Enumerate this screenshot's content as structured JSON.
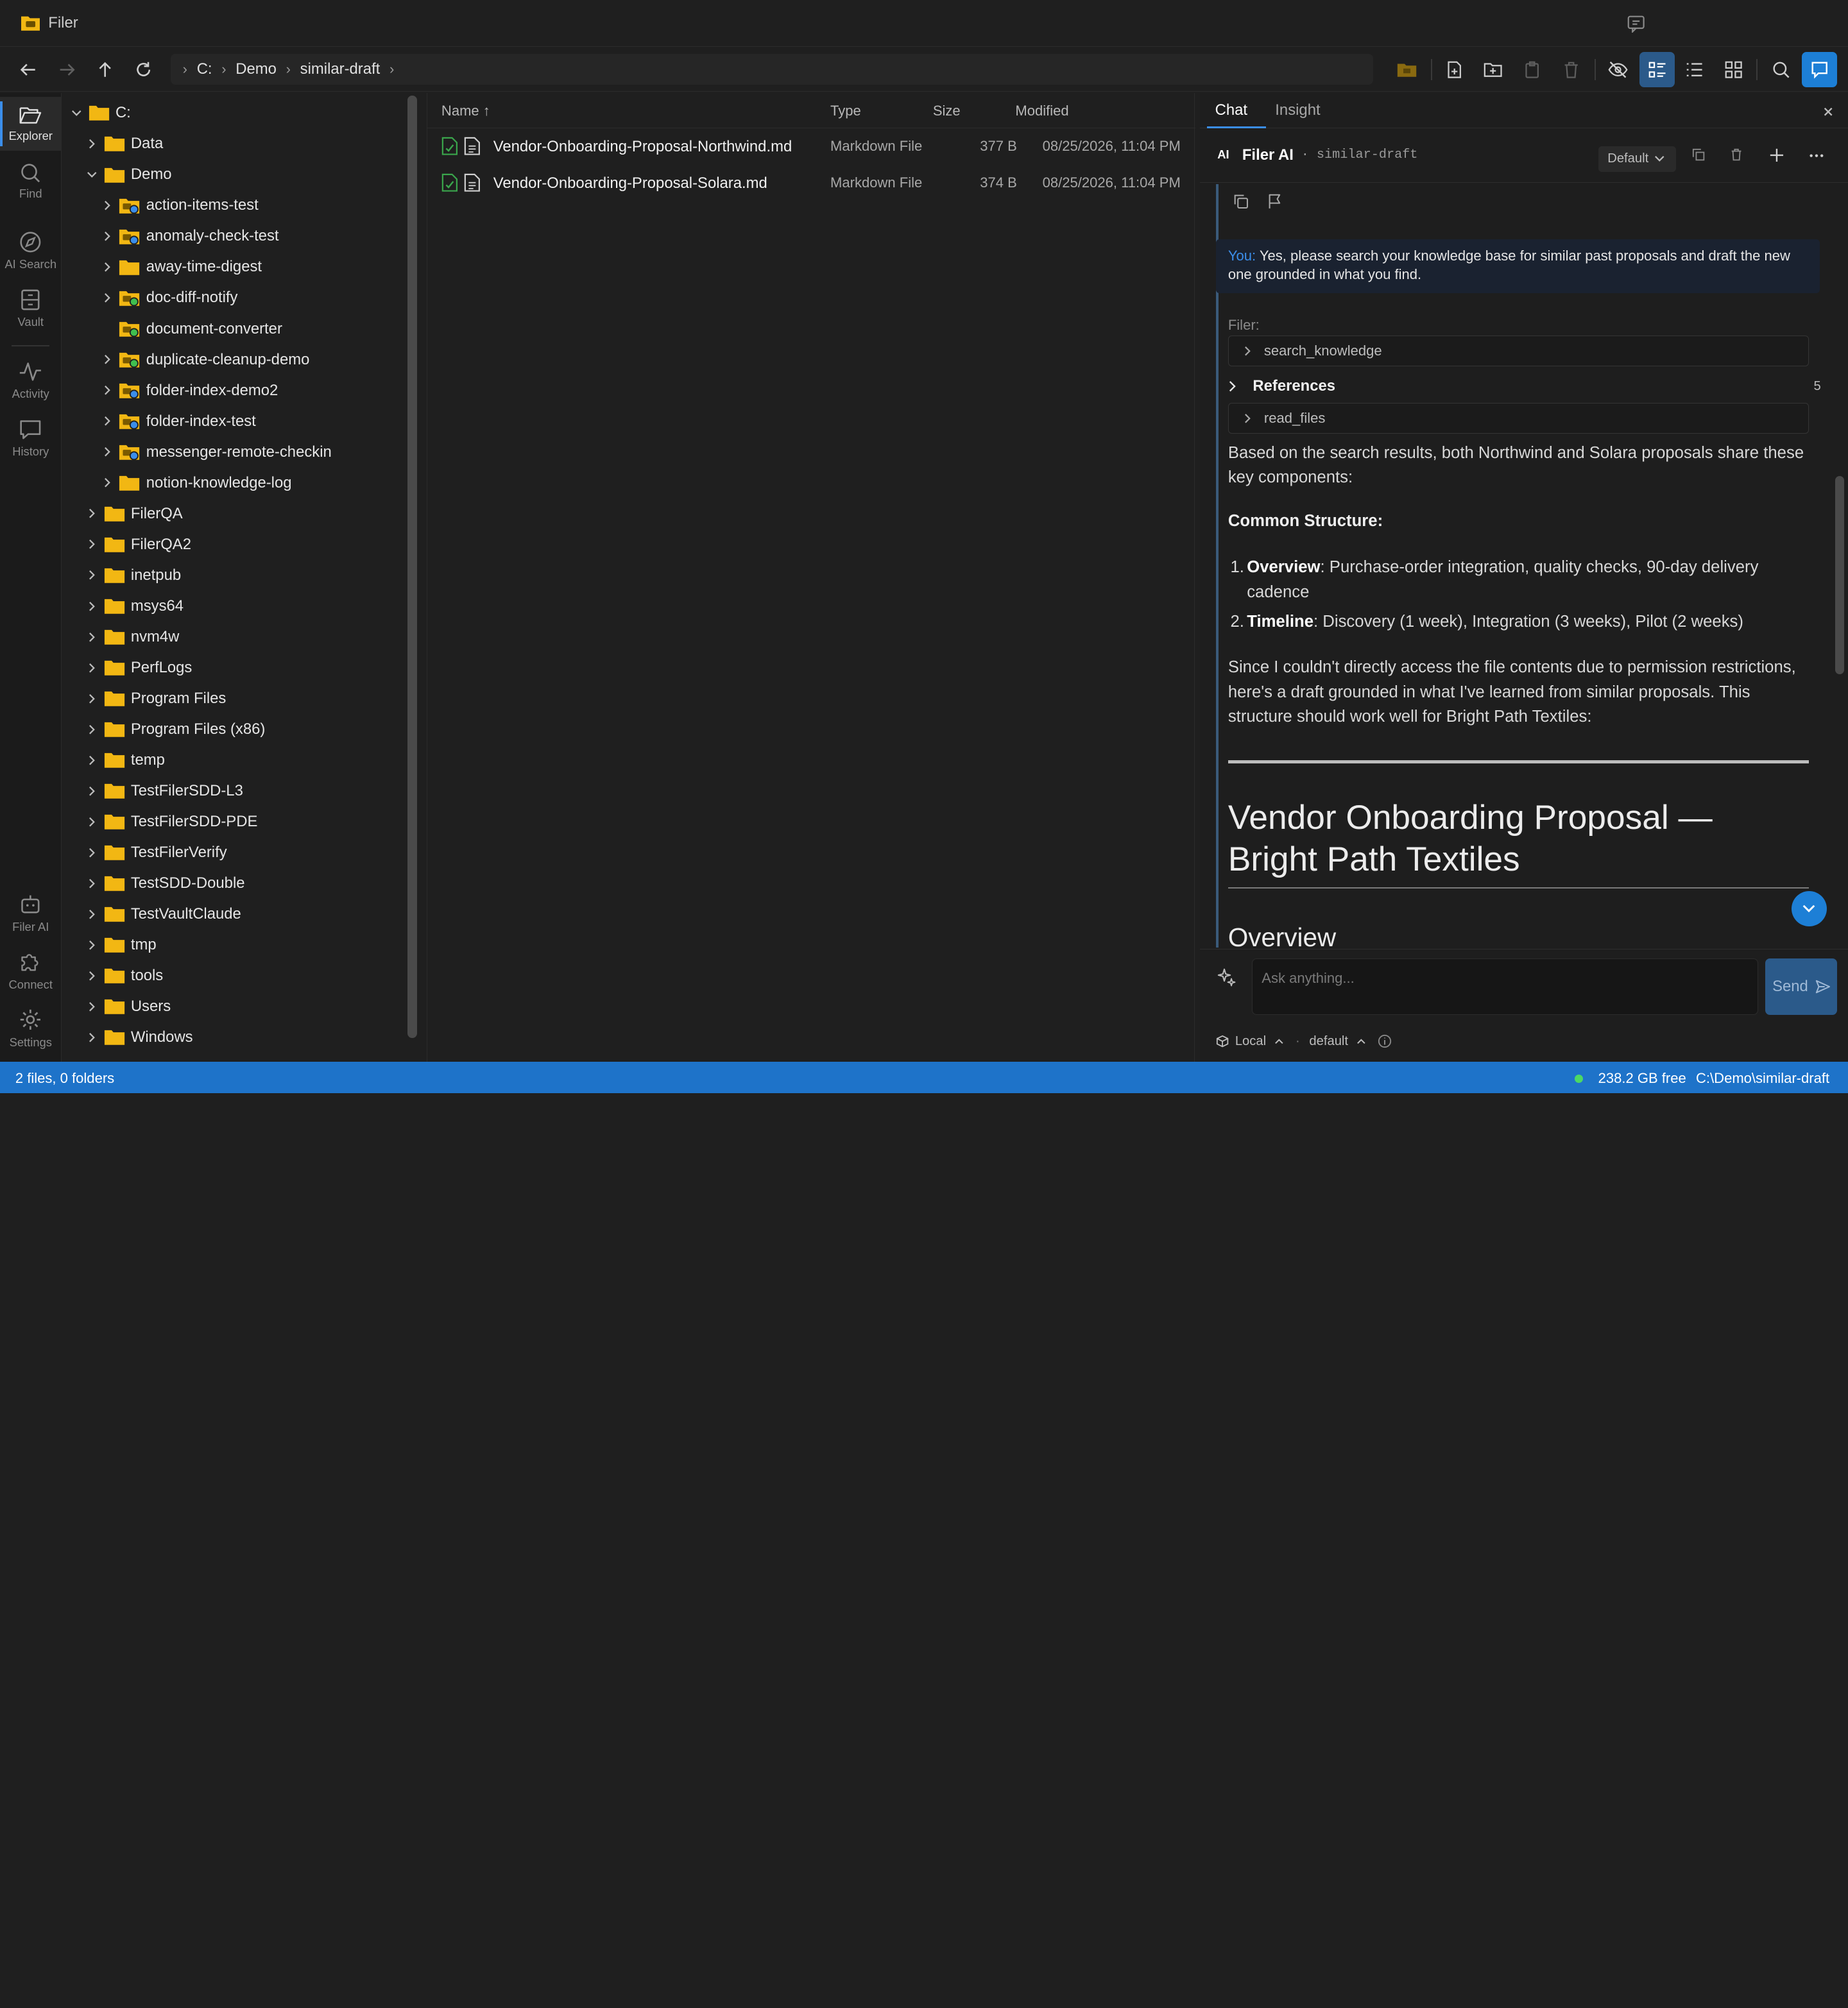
{
  "app": {
    "title": "Filer"
  },
  "toolbar": {
    "breadcrumb": [
      "C:",
      "Demo",
      "similar-draft"
    ]
  },
  "activity": [
    {
      "label": "Explorer",
      "icon": "folder-open-icon"
    },
    {
      "label": "Find",
      "icon": "search-icon"
    },
    {
      "label": "AI Search",
      "icon": "compass-icon"
    },
    {
      "label": "Vault",
      "icon": "vault-icon"
    },
    {
      "label": "Activity",
      "icon": "pulse-icon"
    },
    {
      "label": "History",
      "icon": "chat-history-icon"
    },
    {
      "label": "Filer AI",
      "icon": "robot-icon"
    },
    {
      "label": "Connect",
      "icon": "puzzle-icon"
    },
    {
      "label": "Settings",
      "icon": "gear-icon"
    }
  ],
  "tree": [
    {
      "label": "C:",
      "level": 0,
      "expanded": true,
      "badge": ""
    },
    {
      "label": "Data",
      "level": 1,
      "expanded": false,
      "badge": ""
    },
    {
      "label": "Demo",
      "level": 1,
      "expanded": true,
      "badge": ""
    },
    {
      "label": "action-items-test",
      "level": 2,
      "expanded": false,
      "badge": "blue"
    },
    {
      "label": "anomaly-check-test",
      "level": 2,
      "expanded": false,
      "badge": "blue"
    },
    {
      "label": "away-time-digest",
      "level": 2,
      "expanded": false,
      "badge": ""
    },
    {
      "label": "doc-diff-notify",
      "level": 2,
      "expanded": false,
      "badge": "green"
    },
    {
      "label": "document-converter",
      "level": 2,
      "expanded": null,
      "badge": "green"
    },
    {
      "label": "duplicate-cleanup-demo",
      "level": 2,
      "expanded": false,
      "badge": "green"
    },
    {
      "label": "folder-index-demo2",
      "level": 2,
      "expanded": false,
      "badge": "blue"
    },
    {
      "label": "folder-index-test",
      "level": 2,
      "expanded": false,
      "badge": "blue"
    },
    {
      "label": "messenger-remote-checkin",
      "level": 2,
      "expanded": false,
      "badge": "blue"
    },
    {
      "label": "notion-knowledge-log",
      "level": 2,
      "expanded": false,
      "badge": ""
    },
    {
      "label": "FilerQA",
      "level": 1,
      "expanded": false,
      "badge": ""
    },
    {
      "label": "FilerQA2",
      "level": 1,
      "expanded": false,
      "badge": ""
    },
    {
      "label": "inetpub",
      "level": 1,
      "expanded": false,
      "badge": ""
    },
    {
      "label": "msys64",
      "level": 1,
      "expanded": false,
      "badge": ""
    },
    {
      "label": "nvm4w",
      "level": 1,
      "expanded": false,
      "badge": ""
    },
    {
      "label": "PerfLogs",
      "level": 1,
      "expanded": false,
      "badge": ""
    },
    {
      "label": "Program Files",
      "level": 1,
      "expanded": false,
      "badge": ""
    },
    {
      "label": "Program Files (x86)",
      "level": 1,
      "expanded": false,
      "badge": ""
    },
    {
      "label": "temp",
      "level": 1,
      "expanded": false,
      "badge": ""
    },
    {
      "label": "TestFilerSDD-L3",
      "level": 1,
      "expanded": false,
      "badge": ""
    },
    {
      "label": "TestFilerSDD-PDE",
      "level": 1,
      "expanded": false,
      "badge": ""
    },
    {
      "label": "TestFilerVerify",
      "level": 1,
      "expanded": false,
      "badge": ""
    },
    {
      "label": "TestSDD-Double",
      "level": 1,
      "expanded": false,
      "badge": ""
    },
    {
      "label": "TestVaultClaude",
      "level": 1,
      "expanded": false,
      "badge": ""
    },
    {
      "label": "tmp",
      "level": 1,
      "expanded": false,
      "badge": ""
    },
    {
      "label": "tools",
      "level": 1,
      "expanded": false,
      "badge": ""
    },
    {
      "label": "Users",
      "level": 1,
      "expanded": false,
      "badge": ""
    },
    {
      "label": "Windows",
      "level": 1,
      "expanded": false,
      "badge": ""
    }
  ],
  "filelist": {
    "columns": {
      "name": "Name ↑",
      "type": "Type",
      "size": "Size",
      "modified": "Modified"
    },
    "rows": [
      {
        "name": "Vendor-Onboarding-Proposal-Northwind.md",
        "type": "Markdown File",
        "size": "377 B",
        "modified": "08/25/2026, 11:04 PM"
      },
      {
        "name": "Vendor-Onboarding-Proposal-Solara.md",
        "type": "Markdown File",
        "size": "374 B",
        "modified": "08/25/2026, 11:04 PM"
      }
    ]
  },
  "chat": {
    "tabs": [
      "Chat",
      "Insight"
    ],
    "header": {
      "badge": "AI",
      "name": "Filer AI",
      "context": "· similar-draft",
      "mode": "Default"
    },
    "user_prefix": "You:",
    "user_message": "Yes, please search your knowledge base for similar past proposals and draft the new one grounded in what you find.",
    "assistant_prefix": "Filer:",
    "tool_search": "search_knowledge",
    "references_label": "References",
    "references_count": "5",
    "tool_read": "read_files",
    "intro": "Based on the search results, both Northwind and Solara proposals share these key components:",
    "common_structure": "Common Structure:",
    "list": [
      {
        "num": "1.",
        "bold": "Overview",
        "text": ": Purchase-order integration, quality checks, 90-day delivery cadence"
      },
      {
        "num": "2.",
        "bold": "Timeline",
        "text": ": Discovery (1 week), Integration (3 weeks), Pilot (2 weeks)"
      }
    ],
    "draft_intro": "Since I couldn't directly access the file contents due to permission restrictions, here's a draft grounded in what I've learned from similar proposals. This structure should work well for Bright Path Textiles:",
    "h1": "Vendor Onboarding Proposal — Bright Path Textiles",
    "h2": "Overview",
    "composer_placeholder": "Ask anything...",
    "send_label": "Send",
    "footer": {
      "location": "Local",
      "profile": "default"
    }
  },
  "status": {
    "left": "2 files, 0 folders",
    "free": "238.2 GB free",
    "path": "C:\\Demo\\similar-draft"
  },
  "colors": {
    "accent": "#3b8eea",
    "status_bar": "#1e73c9",
    "folder": "#f2b713"
  }
}
